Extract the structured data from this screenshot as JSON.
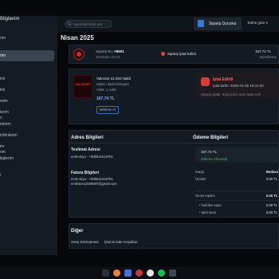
{
  "sidebar": {
    "title": "Bilgilerim",
    "items": [
      {
        "label": "rim"
      },
      {
        "label": "rim"
      },
      {
        "label": "imi"
      },
      {
        "label": "imi"
      },
      {
        "label": "erim"
      },
      {
        "label": "lerim"
      },
      {
        "label": "n"
      },
      {
        "label": "elerim"
      },
      {
        "label": "irdimlerim"
      },
      {
        "label": "im"
      },
      {
        "label": "rim"
      },
      {
        "label": "ilgilerim"
      },
      {
        "label": "i"
      }
    ]
  },
  "topbar": {
    "search_placeholder": "Siparişlerimde ara",
    "tab_label": "Sipariş Durumu",
    "sort_label": "Tarihe göre s"
  },
  "page": {
    "title": "Nisan 2025"
  },
  "order": {
    "number_label": "Sipariş No:",
    "number": "#8901",
    "date": "25 Nisan 18:13",
    "status": "Sipariş İptal Edildi",
    "price": "167.74 TL",
    "seller": "Epin/Düny"
  },
  "product": {
    "image_text": "VALORANT",
    "name": "Valorant 12.250 Nakit",
    "seller": "Satıcı: Epin Dünyası",
    "quantity": "Adet: 1 Adet",
    "price": "167,74 TL",
    "repurchase_label": "Tekrar Al"
  },
  "cancellation": {
    "title": "İptal Edildi",
    "date": "İptal tarihi: 2025-04-25 18:41:03",
    "note": "Sipariş iptali, ödeyiciniz ürün iade edil"
  },
  "address": {
    "title": "Adres Bilgileri",
    "shipping_title": "Teslimat Adresi",
    "shipping_line1": "emle.skya - +905541619781",
    "shipping_line2": "",
    "billing_title": "Fatura Bilgileri",
    "billing_line1": "emle.skya - +905541619781",
    "billing_line2": "emlesnex2009997@gmail.com"
  },
  "payment": {
    "title": "Ödeme Bilgileri",
    "amount": "167.74 TL",
    "status": "Ödeme Alınmadı",
    "rows": [
      {
        "label": "Kargo",
        "value": "Bedava"
      },
      {
        "label": "Ürünler",
        "value": "0.00 TL"
      }
    ],
    "total_label": "Genel toplam",
    "total_value": "0.00 TL",
    "sub_rows": [
      {
        "label": "• İndirilen tutarı",
        "value": "0.00 TL"
      },
      {
        "label": "• İptal tutarı",
        "value": "0.00 TL"
      }
    ]
  },
  "other": {
    "title": "Diğer",
    "links": [
      "Satış Sözleşmesi",
      "İptal & İade Koşulları"
    ]
  },
  "taskbar": {
    "icons": [
      {
        "name": "app-icon-1",
        "color": "#2a3038"
      },
      {
        "name": "app-icon-2",
        "color": "#e8833a"
      },
      {
        "name": "app-icon-3",
        "color": "#4a6fd1"
      },
      {
        "name": "app-icon-4",
        "color": "#c43838"
      },
      {
        "name": "app-icon-5",
        "color": "#e2e2e2"
      },
      {
        "name": "app-icon-6",
        "color": "#1db954"
      },
      {
        "name": "app-icon-7",
        "color": "#3d4652"
      }
    ]
  }
}
